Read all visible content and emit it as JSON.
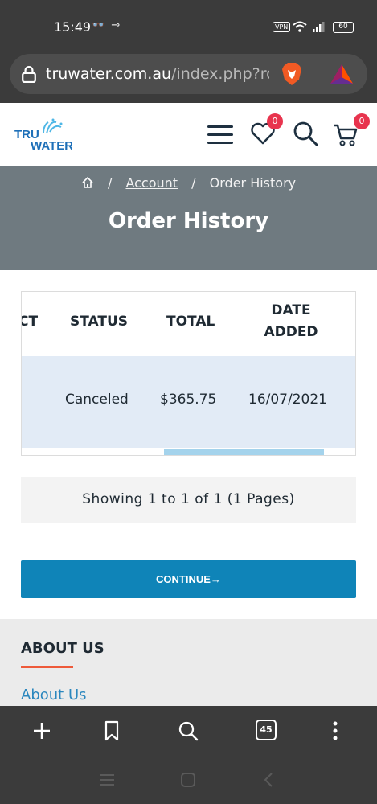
{
  "status_bar": {
    "time": "15:49",
    "left_icons": "👓 ⊸",
    "vpn": "VPN",
    "battery": "60"
  },
  "browser": {
    "url_domain": "truwater.com.au",
    "url_path": "/index.php?ro",
    "tabs_count": "45"
  },
  "header": {
    "logo_text": "TRU WATER",
    "wishlist_count": "0",
    "cart_count": "0"
  },
  "breadcrumb": {
    "sep1": "/",
    "account": "Account",
    "sep2": "/",
    "current": "Order History"
  },
  "page": {
    "title": "Order History"
  },
  "table": {
    "headers": {
      "product": "CT",
      "status": "STATUS",
      "total": "TOTAL",
      "date_line1": "DATE",
      "date_line2": "ADDED"
    },
    "rows": [
      {
        "status": "Canceled",
        "total": "$365.75",
        "date": "16/07/2021"
      }
    ],
    "scroll_position": 0.45
  },
  "pagination": {
    "text": "Showing 1 to 1 of 1 (1 Pages)"
  },
  "continue_button": {
    "label": "CONTINUE→"
  },
  "footer": {
    "heading": "ABOUT US",
    "link": "About Us"
  },
  "colors": {
    "banner": "#6f7a80",
    "primary": "#0f84b8",
    "accent": "#ee5a3a",
    "badge": "#e8344e",
    "row": "#e2ebf6"
  }
}
